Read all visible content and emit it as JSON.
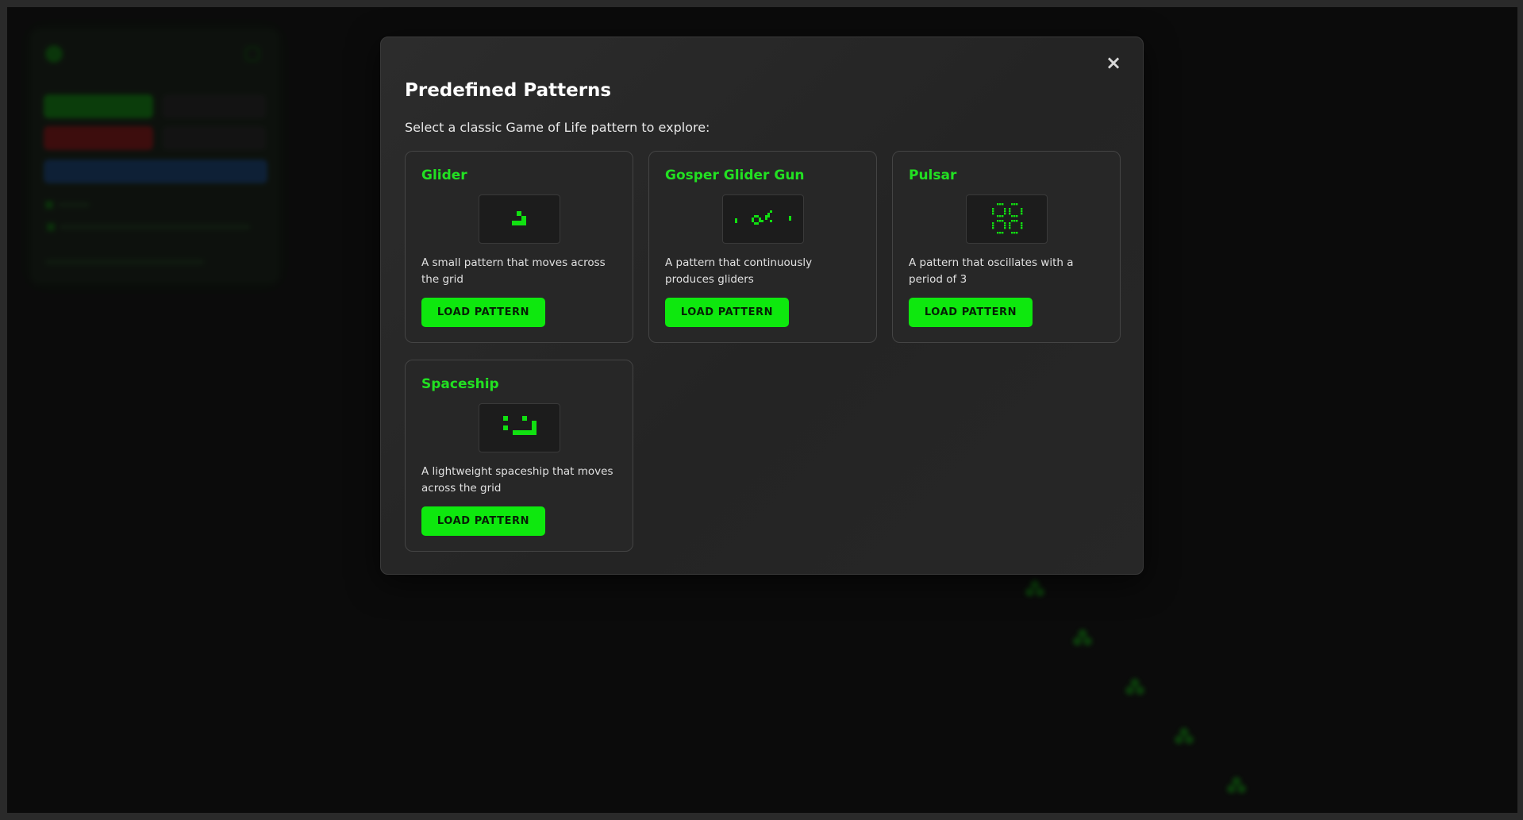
{
  "modal": {
    "title": "Predefined Patterns",
    "subtitle": "Select a classic Game of Life pattern to explore:",
    "close_label": "×"
  },
  "patterns": [
    {
      "name": "Glider",
      "description": "A small pattern that moves across the grid",
      "button_label": "LOAD PATTERN"
    },
    {
      "name": "Gosper Glider Gun",
      "description": "A pattern that continuously produces gliders",
      "button_label": "LOAD PATTERN"
    },
    {
      "name": "Pulsar",
      "description": "A pattern that oscillates with a period of 3",
      "button_label": "LOAD PATTERN"
    },
    {
      "name": "Spaceship",
      "description": "A lightweight spaceship that moves across the grid",
      "button_label": "LOAD PATTERN"
    }
  ],
  "colors": {
    "accent": "#0ee80e",
    "title_green": "#22e022",
    "cell_green": "#11e011",
    "modal_bg": "#282828",
    "page_bg": "#0b0b0b"
  },
  "icons": {
    "close": "close-icon"
  }
}
